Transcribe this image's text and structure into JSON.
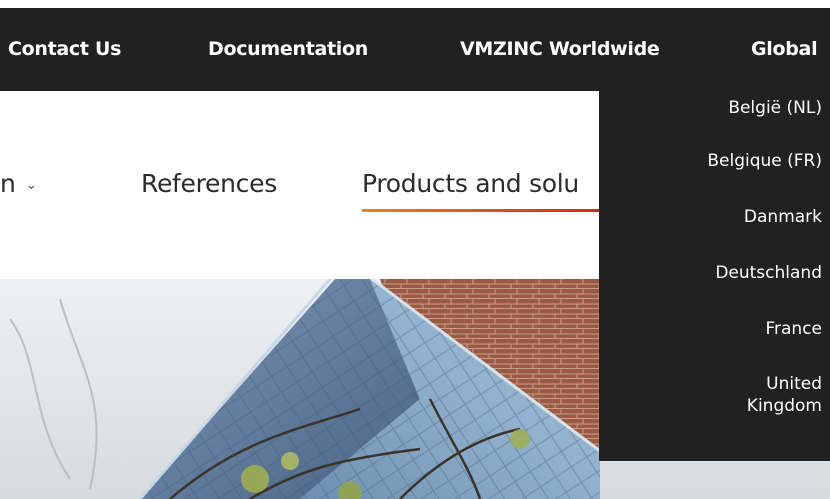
{
  "topbar": {
    "links": [
      "Contact Us",
      "Documentation",
      "VMZINC Worldwide",
      "Global"
    ]
  },
  "nav": {
    "partial_item": "n",
    "references": "References",
    "products": "Products and solu"
  },
  "dropdown": {
    "items": [
      "België (NL)",
      "Belgique (FR)",
      "Danmark",
      "Deutschland",
      "France",
      "United",
      "Kingdom"
    ]
  },
  "colors": {
    "topbar_bg": "#212121",
    "underline_start": "#e9821e",
    "underline_end": "#d9261c"
  }
}
